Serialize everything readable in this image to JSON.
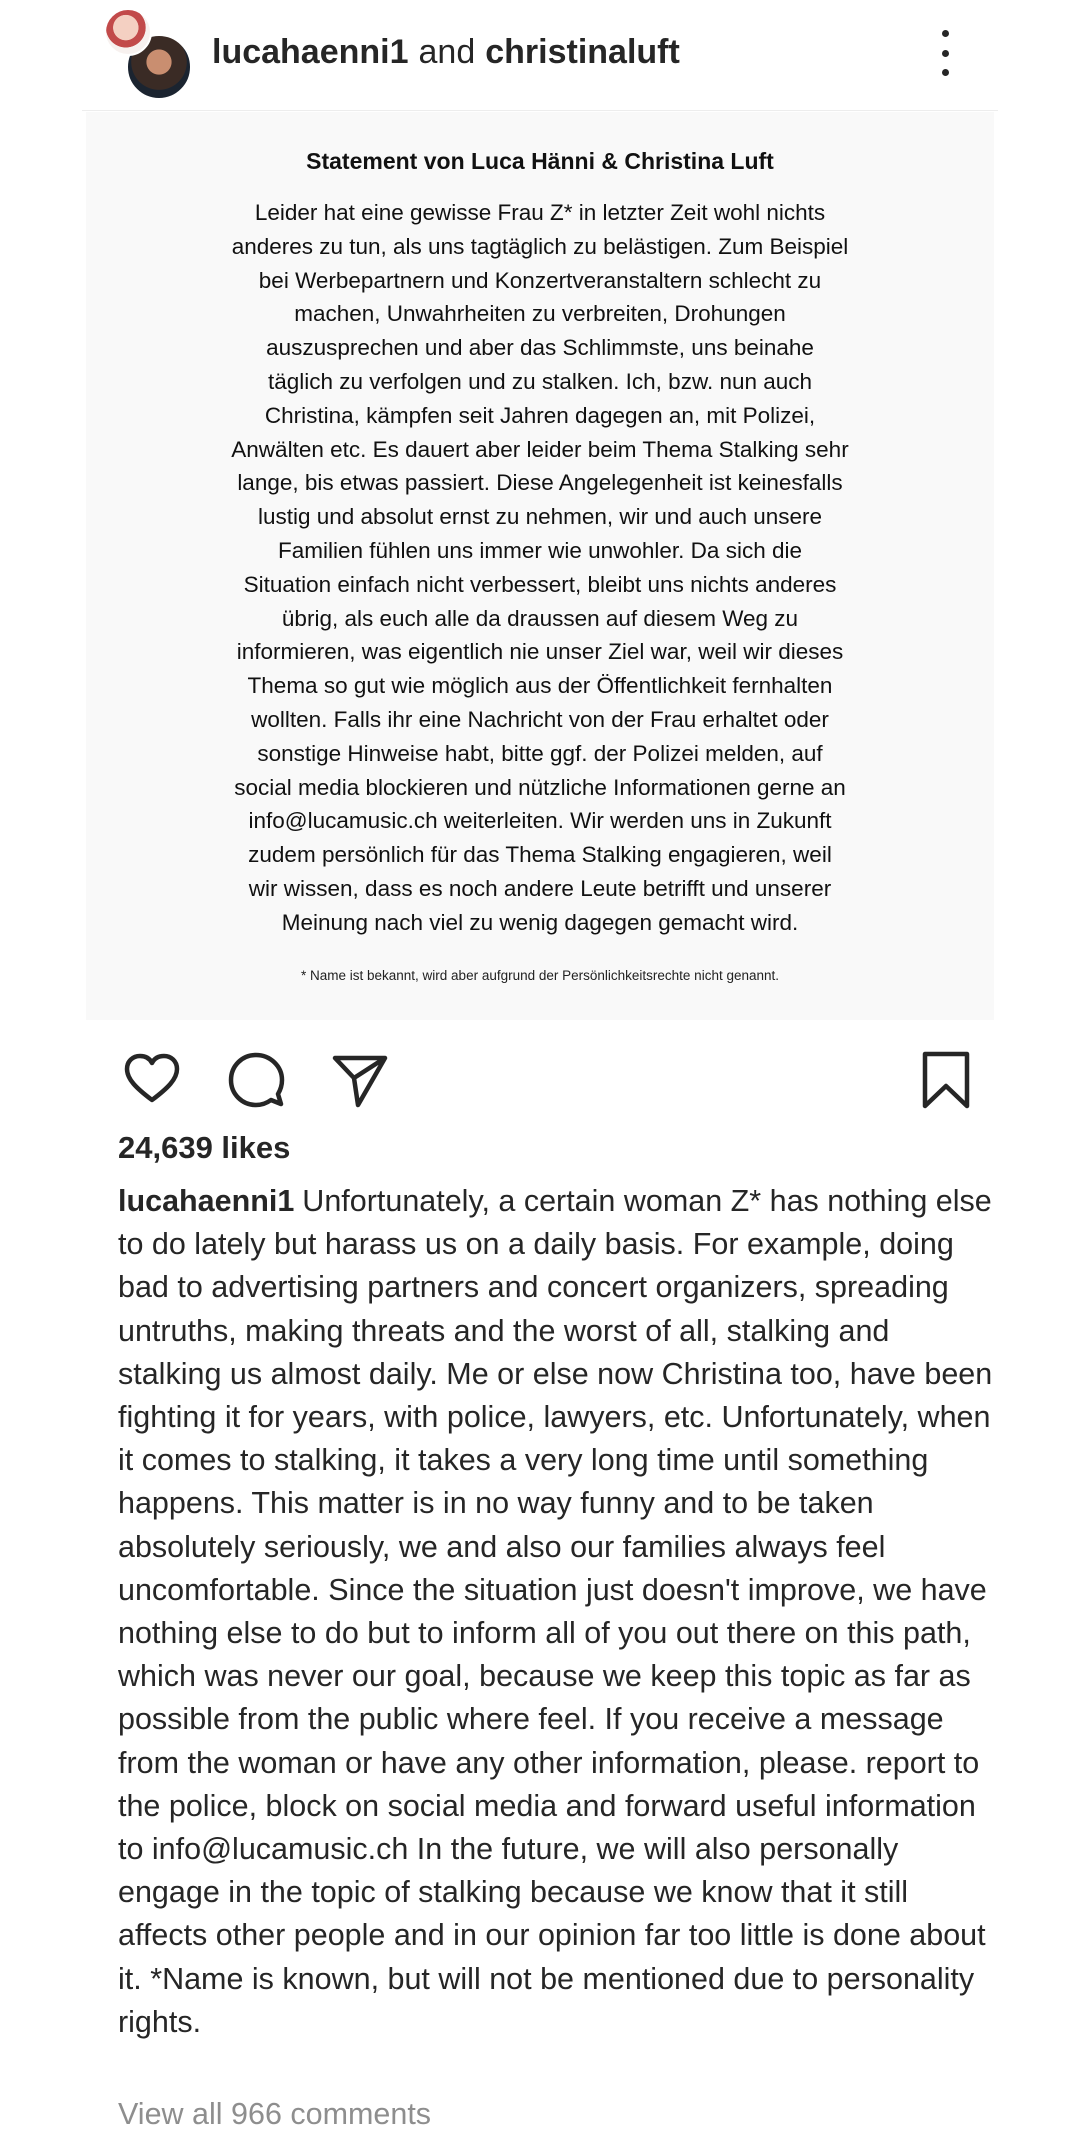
{
  "header": {
    "user1": "lucahaenni1",
    "connector": "and",
    "user2": "christinaluft"
  },
  "post_image": {
    "title": "Statement von Luca Hänni & Christina Luft",
    "body_lines": [
      "Leider hat eine gewisse Frau Z* in letzter Zeit wohl nichts",
      "anderes zu tun, als uns tagtäglich zu belästigen. Zum Beispiel",
      "bei Werbepartnern und Konzertveranstaltern schlecht zu",
      "machen, Unwahrheiten zu verbreiten, Drohungen",
      "auszusprechen und aber das Schlimmste, uns beinahe",
      "täglich zu verfolgen und zu stalken. Ich, bzw. nun auch",
      "Christina, kämpfen seit Jahren dagegen an, mit Polizei,",
      "Anwälten etc. Es dauert aber leider beim Thema Stalking sehr",
      "lange, bis etwas passiert. Diese Angelegenheit ist keinesfalls",
      "lustig und absolut ernst zu nehmen, wir und auch unsere",
      "Familien fühlen uns immer wie unwohler. Da sich die",
      "Situation einfach nicht verbessert, bleibt uns nichts anderes",
      "übrig, als euch alle da draussen auf diesem Weg zu",
      "informieren, was eigentlich nie unser Ziel war, weil wir dieses",
      "Thema so gut wie möglich aus der Öffentlichkeit fernhalten",
      "wollten. Falls ihr eine Nachricht von der Frau erhaltet oder",
      "sonstige Hinweise habt, bitte ggf. der Polizei melden, auf",
      "social media blockieren und nützliche Informationen gerne an",
      "info@lucamusic.ch weiterleiten. Wir werden uns in Zukunft",
      "zudem persönlich für das Thema Stalking engagieren, weil",
      "wir wissen, dass es noch andere Leute betrifft und unserer",
      "Meinung nach viel zu wenig dagegen gemacht wird."
    ],
    "footnote": "* Name ist bekannt, wird aber aufgrund der Persönlichkeitsrechte nicht genannt."
  },
  "actions": {
    "like_icon": "heart-icon",
    "comment_icon": "comment-icon",
    "share_icon": "share-icon",
    "save_icon": "bookmark-icon"
  },
  "likes": "24,639 likes",
  "caption": {
    "username": "lucahaenni1",
    "text": "Unfortunately, a certain woman Z* has nothing else to do lately but harass us on a daily basis. For example, doing bad to advertising partners and concert organizers, spreading untruths, making threats and the worst of all, stalking and stalking us almost daily. Me or else now Christina too, have been fighting it for years, with police, lawyers, etc. Unfortunately, when it comes to stalking, it takes a very long time until something happens. This matter is in no way funny and to be taken absolutely seriously, we and also our families always feel uncomfortable. Since the situation just doesn't improve, we have nothing else to do but to inform all of you out there on this path, which was never our goal, because we keep this topic as far as possible from the public where feel. If you receive a message from the woman or have any other information, please. report to the police, block on social media and forward useful information to info@lucamusic.ch In the future, we will also personally engage in the topic of stalking because we know that it still affects other people and in our opinion far too little is done about it. *Name is known, but will not be mentioned due to personality rights."
  },
  "view_comments": "View all 966 comments"
}
